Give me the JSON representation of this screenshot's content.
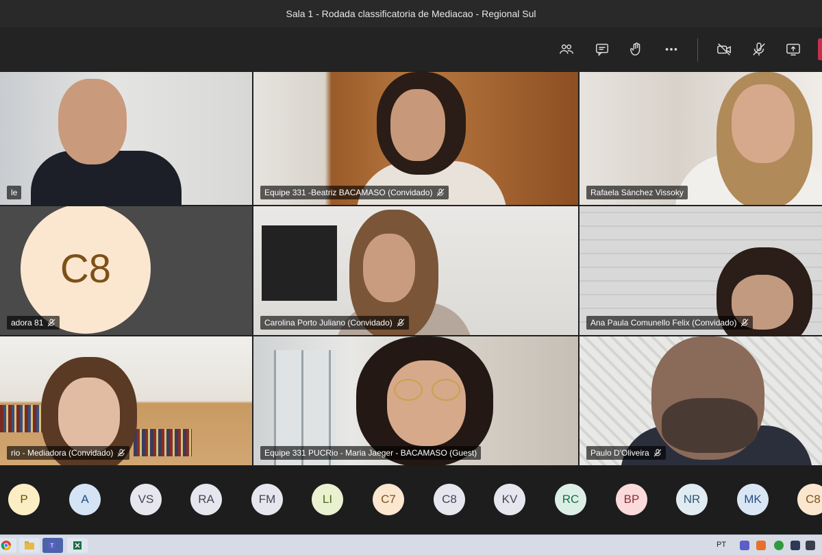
{
  "window": {
    "title": "Sala 1 - Rodada classificatoria de Mediacao - Regional Sul"
  },
  "toolbar": {
    "buttons": [
      "people-icon",
      "chat-icon",
      "raise-hand-icon",
      "more-options-icon",
      "camera-off-icon",
      "mic-off-icon",
      "share-screen-icon"
    ]
  },
  "tiles": [
    {
      "name": "le",
      "muted": false
    },
    {
      "name": "Equipe 331 -Beatriz BACAMASO (Convidado)",
      "muted": true
    },
    {
      "name": "Rafaela Sánchez Vissoky",
      "muted": false
    },
    {
      "name": "adora 81",
      "muted": true,
      "avatar": "C8"
    },
    {
      "name": "Carolina Porto Juliano (Convidado)",
      "muted": true
    },
    {
      "name": "Ana Paula Comunello Felix (Convidado)",
      "muted": true
    },
    {
      "name": "rio - Mediadora (Convidado)",
      "muted": true
    },
    {
      "name": "Equipe 331 PUCRio - Maria Jaeger - BACAMASO (Guest)",
      "muted": false
    },
    {
      "name": "Paulo D'Oliveira",
      "muted": true
    }
  ],
  "participants": [
    {
      "initials": "P",
      "bg": "#fbeec4",
      "fg": "#6b5300"
    },
    {
      "initials": "A",
      "bg": "#d5e4f4",
      "fg": "#1d4e80"
    },
    {
      "initials": "VS",
      "bg": "#e6e6ee",
      "fg": "#444455"
    },
    {
      "initials": "RA",
      "bg": "#e6e6ee",
      "fg": "#444455"
    },
    {
      "initials": "FM",
      "bg": "#e6e6ee",
      "fg": "#444455"
    },
    {
      "initials": "LI",
      "bg": "#e9f1d0",
      "fg": "#4f6414"
    },
    {
      "initials": "C7",
      "bg": "#fbe6cf",
      "fg": "#7b5117"
    },
    {
      "initials": "C8",
      "bg": "#e6e6ee",
      "fg": "#444455"
    },
    {
      "initials": "KV",
      "bg": "#e6e6ee",
      "fg": "#444455"
    },
    {
      "initials": "RC",
      "bg": "#dcefe6",
      "fg": "#1e6b47"
    },
    {
      "initials": "BP",
      "bg": "#fadadb",
      "fg": "#8a2d33"
    },
    {
      "initials": "NR",
      "bg": "#e1ecf2",
      "fg": "#2f5870"
    },
    {
      "initials": "MK",
      "bg": "#dbe6f4",
      "fg": "#254e82"
    },
    {
      "initials": "C8",
      "bg": "#fbe6cf",
      "fg": "#7b5117"
    }
  ],
  "taskbar": {
    "language": "PT"
  },
  "colors": {
    "leave": "#c4314b",
    "background": "#1f1f1f"
  }
}
